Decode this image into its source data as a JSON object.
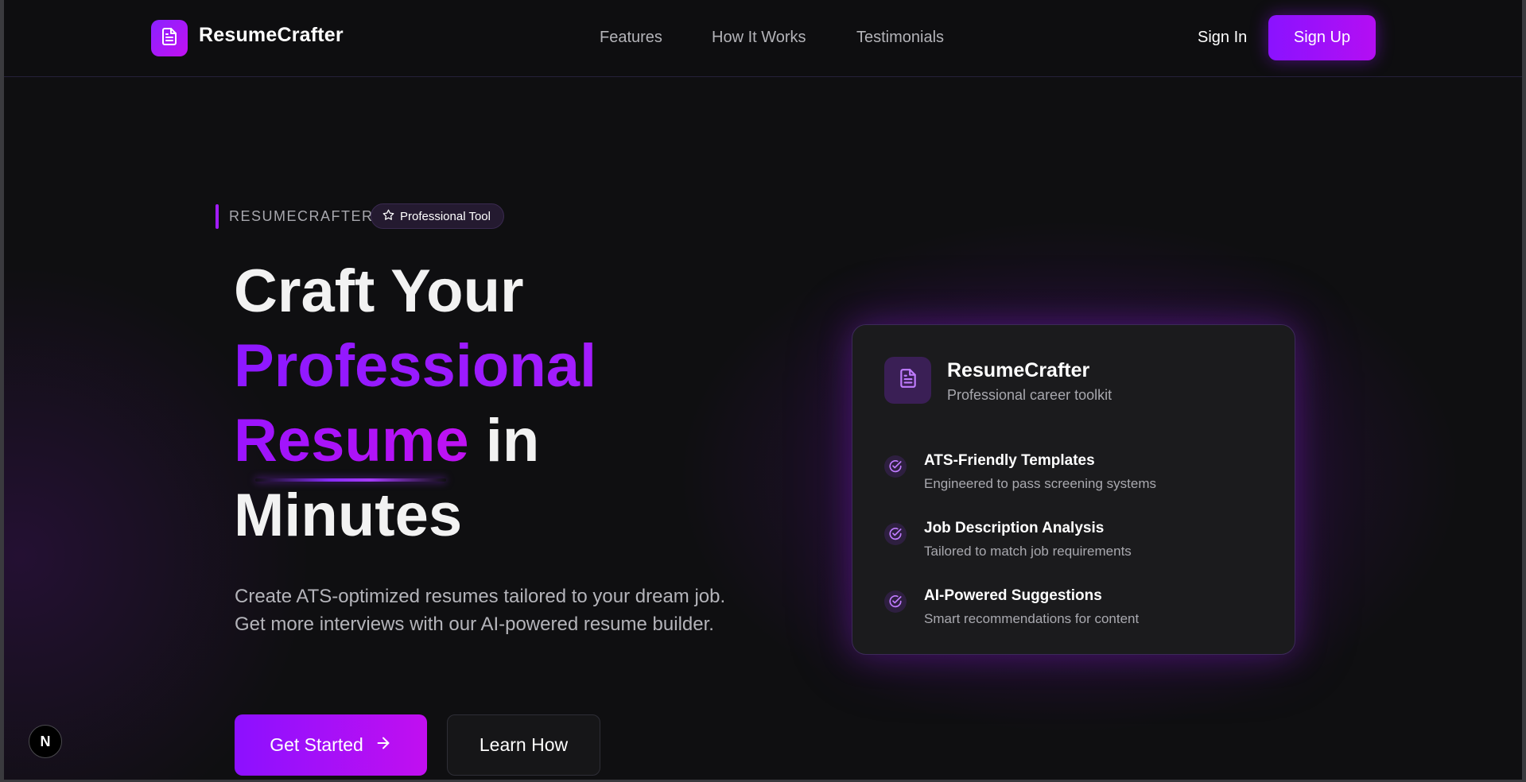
{
  "nav": {
    "brand": "ResumeCrafter",
    "links": [
      "Features",
      "How It Works",
      "Testimonials"
    ],
    "sign_in": "Sign In",
    "sign_up": "Sign Up"
  },
  "hero": {
    "eyebrow": "RESUMECRAFTER",
    "pill": "Professional Tool",
    "headline": {
      "line1": "Craft Your",
      "line2": "Professional",
      "line3_accent": "Resume",
      "line3_rest": " in",
      "line4": "Minutes"
    },
    "subtext": "Create ATS-optimized resumes tailored to your dream job. Get more interviews with our AI-powered resume builder.",
    "primary_button": "Get Started",
    "secondary_button": "Learn How"
  },
  "card": {
    "title": "ResumeCrafter",
    "subtitle": "Professional career toolkit",
    "features": [
      {
        "title": "ATS-Friendly Templates",
        "desc": "Engineered to pass screening systems"
      },
      {
        "title": "Job Description Analysis",
        "desc": "Tailored to match job requirements"
      },
      {
        "title": "AI-Powered Suggestions",
        "desc": "Smart recommendations for content"
      }
    ]
  },
  "floating_badge": "N",
  "colors": {
    "accent": "#9a14ff",
    "accent_pink": "#c10ff0",
    "background": "#0f0f11"
  }
}
